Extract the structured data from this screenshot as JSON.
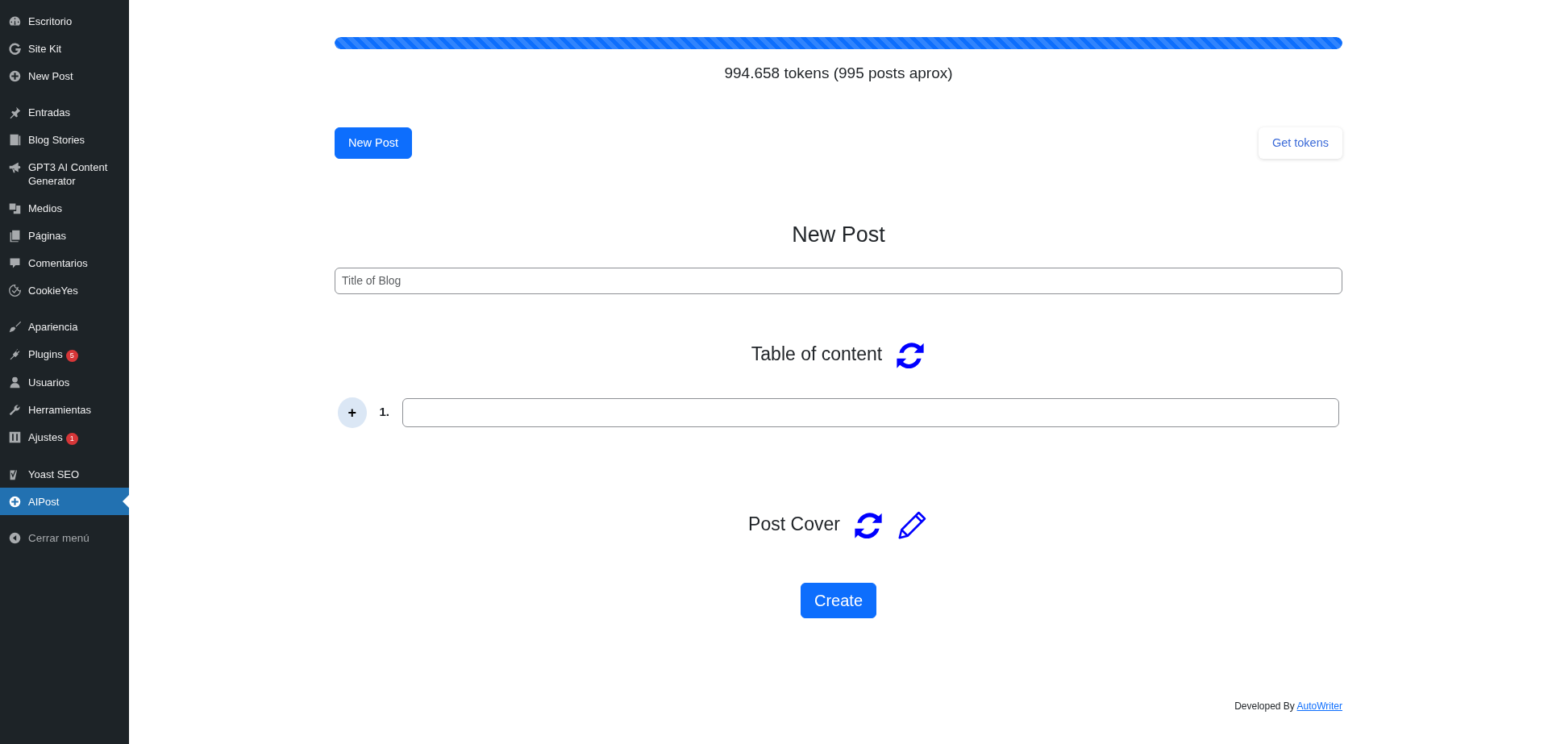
{
  "sidebar": {
    "groups": [
      [
        {
          "label": "Escritorio",
          "selected": false
        },
        {
          "label": "Site Kit",
          "selected": false
        },
        {
          "label": "New Post",
          "selected": false
        }
      ],
      [
        {
          "label": "Entradas",
          "selected": false
        },
        {
          "label": "Blog Stories",
          "selected": false
        },
        {
          "label": "GPT3 AI Content Generator",
          "selected": false
        },
        {
          "label": "Medios",
          "selected": false
        },
        {
          "label": "Páginas",
          "selected": false
        },
        {
          "label": "Comentarios",
          "selected": false
        },
        {
          "label": "CookieYes",
          "selected": false
        }
      ],
      [
        {
          "label": "Apariencia",
          "selected": false
        },
        {
          "label": "Plugins",
          "badge": "5",
          "selected": false
        },
        {
          "label": "Usuarios",
          "selected": false
        },
        {
          "label": "Herramientas",
          "selected": false
        },
        {
          "label": "Ajustes",
          "badge": "1",
          "selected": false
        }
      ],
      [
        {
          "label": "Yoast SEO",
          "selected": false
        },
        {
          "label": "AIPost",
          "selected": true
        }
      ]
    ],
    "collapse_label": "Cerrar menú"
  },
  "tokens": {
    "level": 1,
    "text": "994.658 tokens (995 posts aprox)"
  },
  "actions": {
    "new_post": "New Post",
    "get_tokens": "Get tokens"
  },
  "form": {
    "heading": "New Post",
    "title_field": {
      "placeholder": "Title of Blog"
    },
    "toc_heading": "Table of content",
    "add_item": "+",
    "toc_items": [
      {
        "number": "1.",
        "value": ""
      }
    ],
    "cover_heading": "Post Cover",
    "create": "Create"
  },
  "footer": {
    "text": "Developed By",
    "link": "AutoWriter"
  }
}
